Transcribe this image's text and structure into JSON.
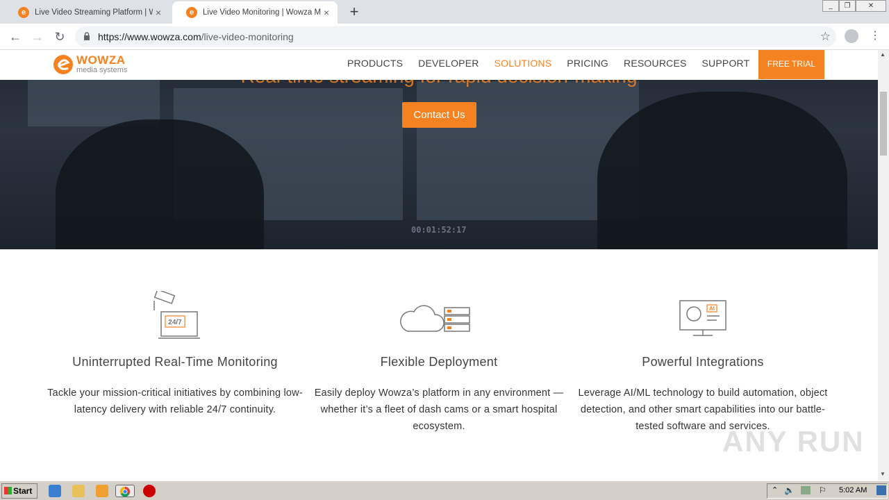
{
  "browser": {
    "tabs": [
      {
        "title": "Live Video Streaming Platform | Wow",
        "favicon": "wowza-favicon",
        "active": false
      },
      {
        "title": "Live Video Monitoring | Wowza Medi",
        "favicon": "wowza-favicon",
        "active": true
      }
    ],
    "new_tab_label": "+",
    "close_label": "×",
    "url_host": "https://www.wowza.com",
    "url_path": "/live-video-monitoring"
  },
  "site": {
    "logo": {
      "word": "WOWZA",
      "sub": "media systems",
      "mark": "e"
    },
    "nav": [
      {
        "label": "PRODUCTS",
        "active": false
      },
      {
        "label": "DEVELOPER",
        "active": false
      },
      {
        "label": "SOLUTIONS",
        "active": true
      },
      {
        "label": "PRICING",
        "active": false
      },
      {
        "label": "RESOURCES",
        "active": false
      },
      {
        "label": "SUPPORT",
        "active": false
      }
    ],
    "free_trial": "FREE TRIAL",
    "accent_color": "#f58220"
  },
  "hero": {
    "headline": "Real-time streaming for rapid decision-making",
    "cta": "Contact Us",
    "timecode": "00:01:52:17"
  },
  "features": [
    {
      "icon": "cctv-laptop-icon",
      "icon_text": "24/7",
      "title": "Uninterrupted Real-Time Monitoring",
      "body": "Tackle your mission-critical initiatives by combining low-latency delivery with reliable 24/7 continuity."
    },
    {
      "icon": "cloud-server-icon",
      "title": "Flexible Deployment",
      "body": "Easily deploy Wowza’s platform in any environment — whether it’s a fleet of dash cams or a smart hospital ecosystem."
    },
    {
      "icon": "ai-monitor-icon",
      "icon_text": "AI",
      "title": "Powerful Integrations",
      "body": "Leverage AI/ML technology to build automation, object detection, and other smart capabilities into our battle-tested software and services."
    }
  ],
  "watermark": "ANY RUN",
  "taskbar": {
    "start": "Start",
    "clock": "5:02 AM"
  }
}
